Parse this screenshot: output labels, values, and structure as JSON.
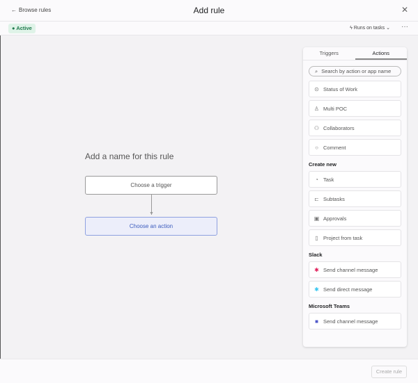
{
  "header": {
    "back": "Browse rules",
    "title": "Add rule"
  },
  "subbar": {
    "status": "Active",
    "runs_on": "Runs on tasks"
  },
  "canvas": {
    "name_placeholder": "Add a name for this rule",
    "trigger": "Choose a trigger",
    "action": "Choose an action"
  },
  "panel": {
    "tabs": [
      "Triggers",
      "Actions"
    ],
    "search_placeholder": "Search by action or app name",
    "top_items": [
      "Status of Work",
      "Multi POC",
      "Collaborators",
      "Comment"
    ],
    "create_new": {
      "title": "Create new",
      "items": [
        "Task",
        "Subtasks",
        "Approvals",
        "Project from task"
      ]
    },
    "slack": {
      "title": "Slack",
      "items": [
        "Send channel message",
        "Send direct message"
      ]
    },
    "teams": {
      "title": "Microsoft Teams",
      "items": [
        "Send channel message"
      ]
    }
  },
  "footer": {
    "create": "Create rule"
  }
}
